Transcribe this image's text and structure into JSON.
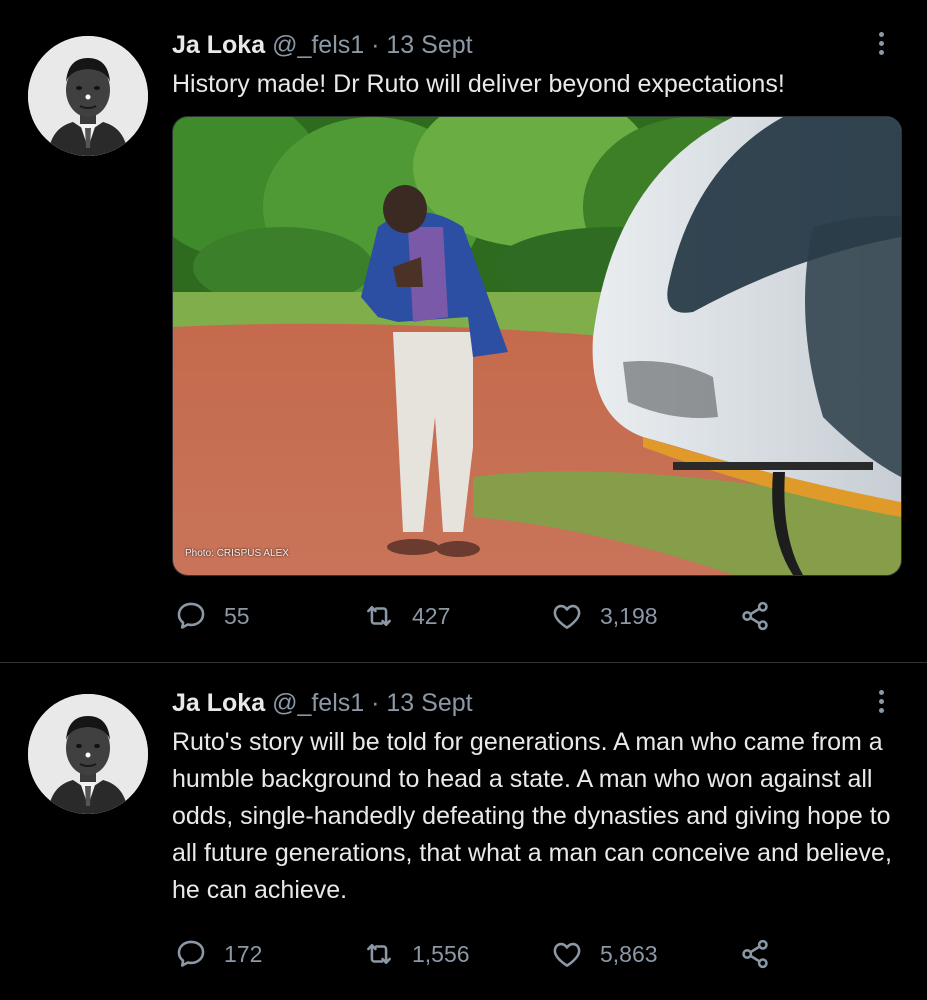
{
  "tweets": [
    {
      "name": "Ja Loka",
      "handle": "@_fels1",
      "separator": "·",
      "date": "13 Sept",
      "text": "History made! Dr Ruto will deliver beyond expectations!",
      "photo_credit": "Photo: CRISPUS ALEX",
      "replies": "55",
      "retweets": "427",
      "likes": "3,198"
    },
    {
      "name": "Ja Loka",
      "handle": "@_fels1",
      "separator": "·",
      "date": "13 Sept",
      "text": "Ruto's story will be told for generations. A man who came from a humble background to head a state. A man who won against all odds, single-handedly defeating the dynasties and giving hope to all future generations, that what a man can conceive and believe, he can achieve.",
      "replies": "172",
      "retweets": "1,556",
      "likes": "5,863"
    }
  ],
  "icons": {
    "reply": "reply-icon",
    "retweet": "retweet-icon",
    "like": "heart-icon",
    "share": "share-icon",
    "more": "more-vertical-icon"
  },
  "colors": {
    "background": "#000000",
    "text": "#e7e9ea",
    "muted": "#8b98a5",
    "divider": "#2f3336"
  }
}
